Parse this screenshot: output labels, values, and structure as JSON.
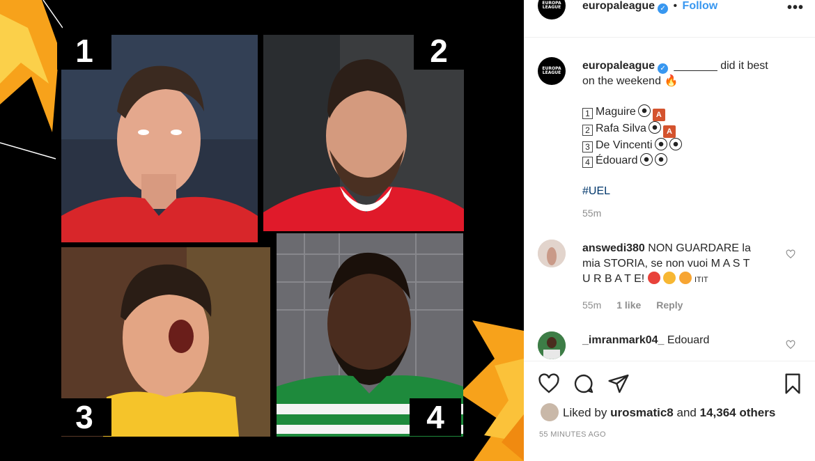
{
  "post": {
    "image_numbers": [
      "1",
      "2",
      "3",
      "4"
    ]
  },
  "header": {
    "username": "europaleague",
    "dot": "•",
    "follow_label": "Follow",
    "more_label": "•••",
    "avatar_text": "EUROPA LEAGUE"
  },
  "caption": {
    "username": "europaleague",
    "line1_text": "_______ did it best",
    "line2_text": "on the weekend",
    "items": [
      {
        "num": "1",
        "name": "Maguire"
      },
      {
        "num": "2",
        "name": "Rafa Silva"
      },
      {
        "num": "3",
        "name": "De Vincenti"
      },
      {
        "num": "4",
        "name": "Édouard"
      }
    ],
    "card_letter": "A",
    "hashtag": "#UEL",
    "time": "55m"
  },
  "comments": [
    {
      "username": "answedi380",
      "text_line1": "NON GUARDARE la",
      "text_line2": "mia STORIA, se non vuoi M A S T",
      "text_line3": "U R B A T E!",
      "text_suffix": "ITIT",
      "time": "55m",
      "likes": "1 like",
      "reply": "Reply"
    },
    {
      "username": "_imranmark04_",
      "text": "Edouard"
    }
  ],
  "likes": {
    "prefix": "Liked by",
    "user": "urosmatic8",
    "and": "and",
    "count": "14,364 others"
  },
  "timestamp": "55 MINUTES AGO",
  "colors": {
    "link_blue": "#3897f0",
    "hashtag_blue": "#00376b",
    "meta_gray": "#8e8e8e",
    "uel_orange": "#f39c12"
  }
}
